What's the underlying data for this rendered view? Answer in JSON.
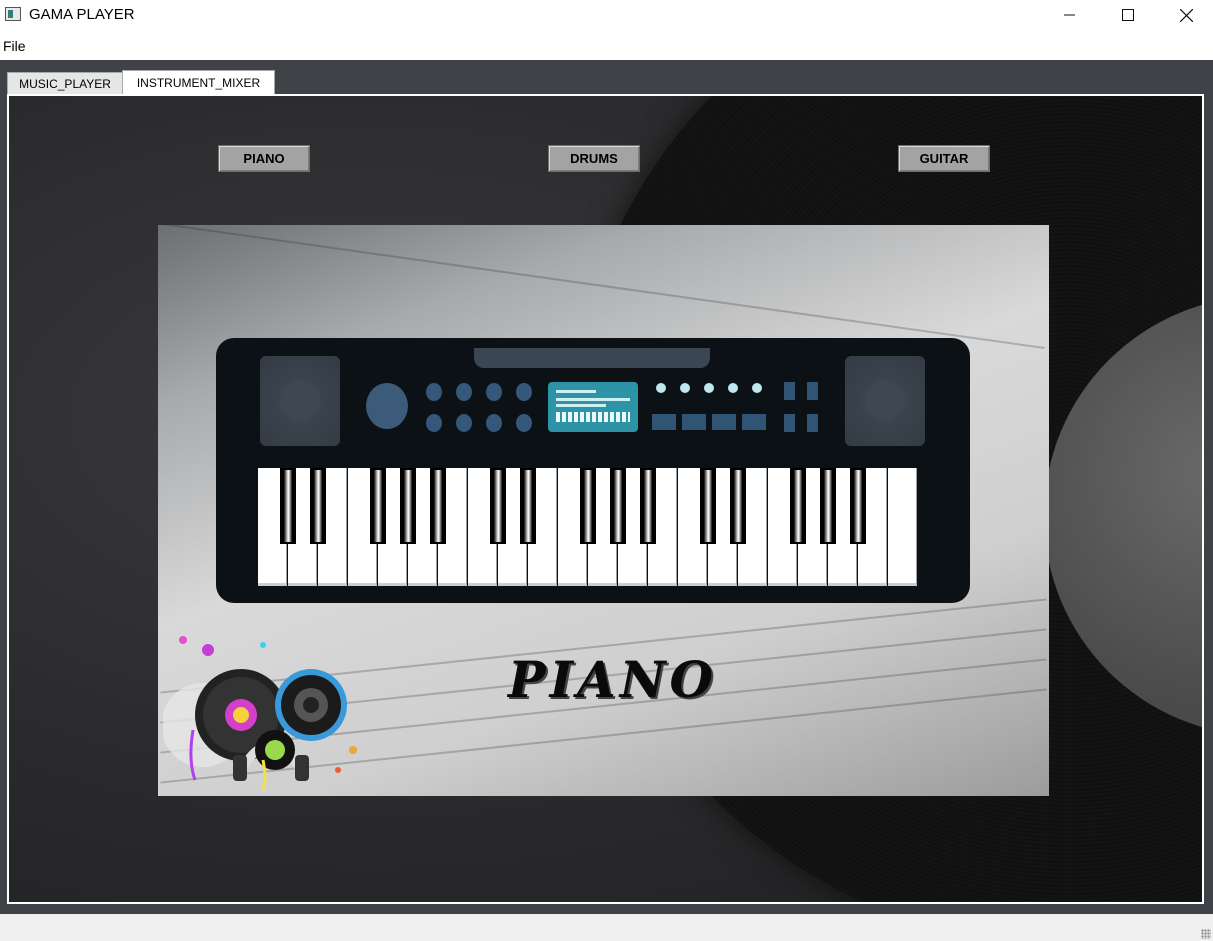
{
  "window": {
    "title": "GAMA PLAYER",
    "icon": "app-icon"
  },
  "menubar": {
    "items": [
      {
        "label": "File"
      }
    ]
  },
  "tabs": [
    {
      "label": "MUSIC_PLAYER",
      "active": false
    },
    {
      "label": "INSTRUMENT_MIXER",
      "active": true
    }
  ],
  "instruments": {
    "piano": "PIANO",
    "drums": "DRUMS",
    "guitar": "GUITAR"
  },
  "display": {
    "instrument_name": "PIANO",
    "image": "keyboard-synth-illustration",
    "logo": "music-logo-vinyl-speaker-headphones"
  },
  "colors": {
    "frame": "#3f4247",
    "button": "#a3a3a3",
    "keyboard_body": "#0c1116",
    "screen": "#2d93a6"
  }
}
